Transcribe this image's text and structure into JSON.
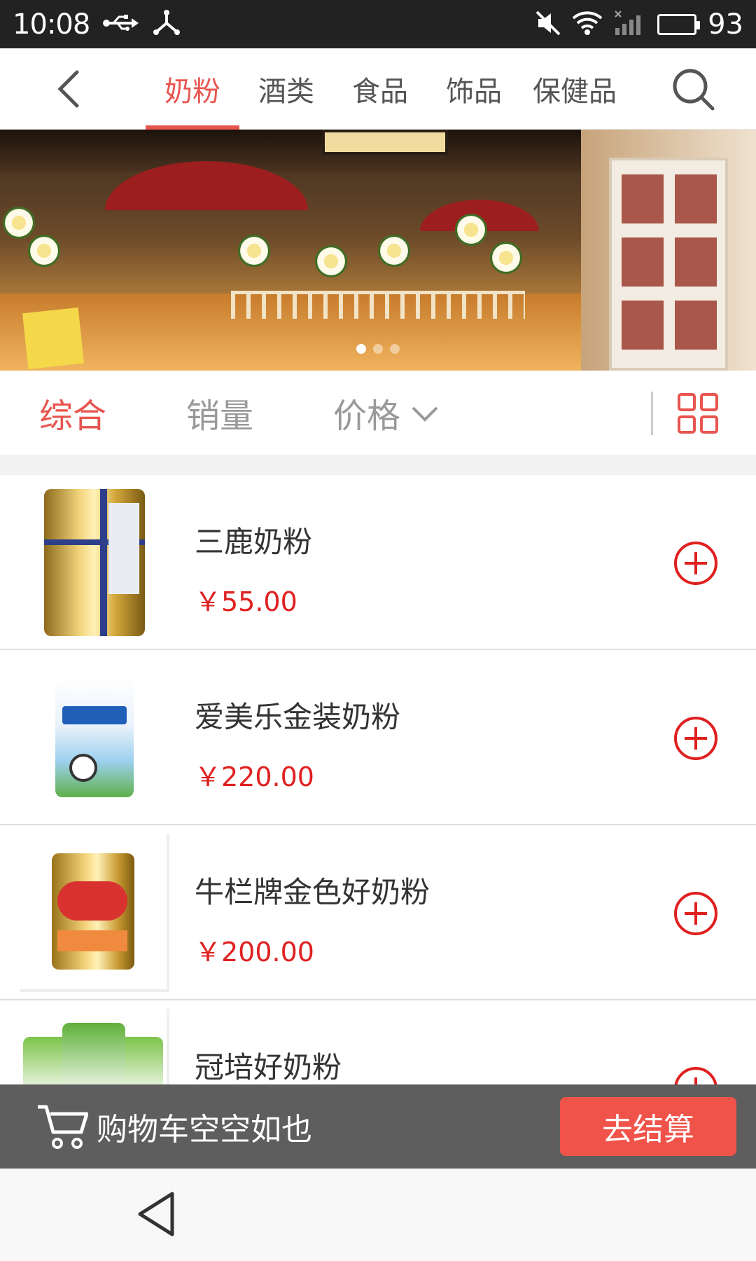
{
  "status_bar": {
    "time": "10:08",
    "battery_level": "93",
    "icons": [
      "usb-icon",
      "share-icon",
      "mute-icon",
      "wifi-icon",
      "signal-icon",
      "battery-icon"
    ]
  },
  "top_nav": {
    "tabs": [
      {
        "label": "奶粉",
        "active": true
      },
      {
        "label": "酒类",
        "active": false
      },
      {
        "label": "食品",
        "active": false
      },
      {
        "label": "饰品",
        "active": false
      },
      {
        "label": "保健品",
        "active": false
      }
    ],
    "icons": [
      "back-arrow-icon",
      "search-icon"
    ]
  },
  "banner": {
    "slides": 3,
    "active_slide": 1
  },
  "sort_bar": {
    "options": [
      {
        "label": "综合",
        "active": true
      },
      {
        "label": "销量",
        "active": false
      },
      {
        "label": "价格",
        "active": false
      }
    ],
    "icons": [
      "chevron-down-icon",
      "grid-view-icon"
    ]
  },
  "products": [
    {
      "name": "三鹿奶粉",
      "price": "￥55.00"
    },
    {
      "name": "爱美乐金装奶粉",
      "price": "￥220.00"
    },
    {
      "name": "牛栏牌金色好奶粉",
      "price": "￥200.00"
    },
    {
      "name": "冠培好奶粉",
      "price": ""
    }
  ],
  "cart_bar": {
    "empty_text": "购物车空空如也",
    "checkout_label": "去结算"
  },
  "colors": {
    "accent": "#e8554f",
    "price": "#e02020",
    "cart_bar": "#5e5e5e",
    "checkout": "#f0534a"
  }
}
